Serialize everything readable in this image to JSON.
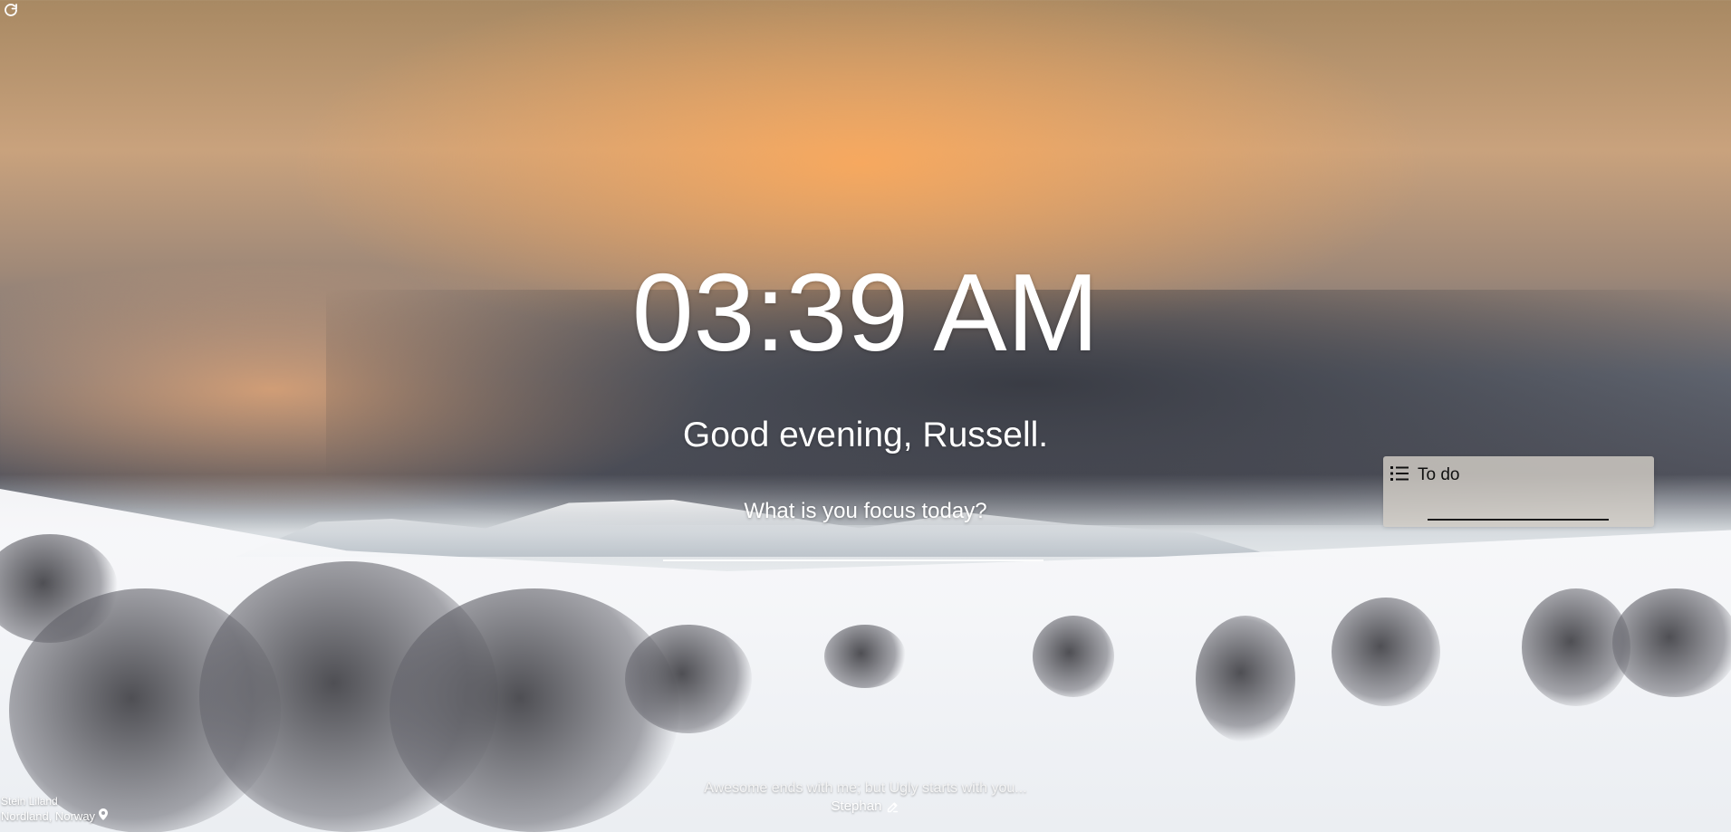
{
  "clock": {
    "time": "03:39 AM"
  },
  "greeting": {
    "text": "Good evening, Russell."
  },
  "focus": {
    "prompt": "What is you focus today?",
    "value": ""
  },
  "todo": {
    "title": "To do",
    "icon": "list-icon",
    "input_value": ""
  },
  "photo_credit": {
    "photographer": "Stein Liland",
    "location": "Nordland, Norway",
    "location_icon": "map-marker-icon"
  },
  "quote": {
    "text": "Awesome ends with me; but Ugly starts with you...",
    "author": "Stephan",
    "edit_icon": "edit-icon"
  },
  "controls": {
    "refresh_icon": "refresh-icon"
  }
}
